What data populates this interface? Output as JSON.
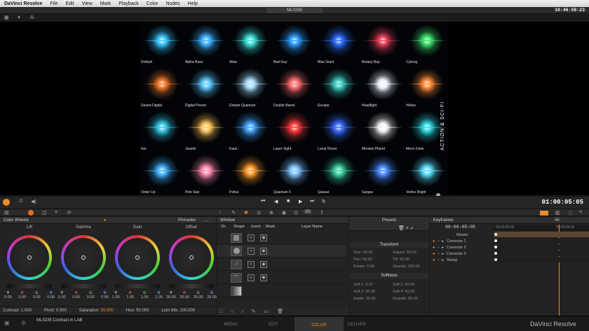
{
  "menubar": {
    "app": "DaVinci Resolve",
    "items": [
      "File",
      "Edit",
      "View",
      "Mark",
      "Playback",
      "Color",
      "Nodes",
      "Help"
    ],
    "clock": "10:46:59:23"
  },
  "viewer": {
    "clip": "ML0235",
    "side_label": "ACTION & SCI-FI"
  },
  "presets": [
    {
      "label": "Default",
      "color": "#39c6ff"
    },
    {
      "label": "Alpha Base",
      "color": "#3fb1ff"
    },
    {
      "label": "Atlas",
      "color": "#3ee0d8"
    },
    {
      "label": "Bad Guy",
      "color": "#2f9cff"
    },
    {
      "label": "Blue Giant",
      "color": "#2b6bff"
    },
    {
      "label": "Botany Bay",
      "color": "#e2405b"
    },
    {
      "label": "Cyborg",
      "color": "#3de06b"
    },
    {
      "label": "Desert Digital",
      "color": "#f07a2a"
    },
    {
      "label": "Digital Preset",
      "color": "#5cc8ff"
    },
    {
      "label": "Distant Quantum",
      "color": "#a8dcff"
    },
    {
      "label": "Double Barrel",
      "color": "#ff6f72"
    },
    {
      "label": "Escape",
      "color": "#3cc9c0"
    },
    {
      "label": "Headlight",
      "color": "#eef3ff"
    },
    {
      "label": "Helios",
      "color": "#ff8a3a"
    },
    {
      "label": "Isis",
      "color": "#34c9e8"
    },
    {
      "label": "Javelin",
      "color": "#ffc65c"
    },
    {
      "label": "Kaus",
      "color": "#3fa3ff"
    },
    {
      "label": "Laser Sight",
      "color": "#ff3b3b"
    },
    {
      "label": "Lunar Rover",
      "color": "#3a6bff"
    },
    {
      "label": "Monkey Planet",
      "color": "#f3f3f3"
    },
    {
      "label": "Moon Glow",
      "color": "#2ed7e0"
    },
    {
      "label": "Order Up",
      "color": "#3fb4ff"
    },
    {
      "label": "Pink Star",
      "color": "#ff8bb0"
    },
    {
      "label": "Pollux",
      "color": "#ff9a2a"
    },
    {
      "label": "Quantum 5",
      "color": "#7cc3ff"
    },
    {
      "label": "Quasar",
      "color": "#3ad0a0"
    },
    {
      "label": "Sargas",
      "color": "#4a8bff"
    },
    {
      "label": "Vortex Bright",
      "color": "#5ae0ff"
    }
  ],
  "transport": {
    "timecode": "01:00:05:05",
    "icons": [
      "skip-start-icon",
      "step-back-icon",
      "stop-icon",
      "play-icon",
      "skip-end-icon",
      "loop-icon"
    ]
  },
  "toolbar2": {
    "badge": "3D"
  },
  "color_wheels": {
    "title": "Color Wheels",
    "mode": "Primaries",
    "wheels": [
      {
        "name": "Lift",
        "values": [
          "0.00",
          "0.00",
          "0.00",
          "0.00"
        ]
      },
      {
        "name": "Gamma",
        "values": [
          "0.00",
          "0.00",
          "0.00",
          "0.00"
        ]
      },
      {
        "name": "Gain",
        "values": [
          "1.00",
          "1.00",
          "1.00",
          "1.00"
        ]
      },
      {
        "name": "Offset",
        "values": [
          "25.00",
          "25.00",
          "25.00",
          "25.00"
        ]
      }
    ],
    "channels": [
      "Y",
      "R",
      "G",
      "B"
    ],
    "params": {
      "contrast": "Contrast: 1.000",
      "pivot": "Pivot: 0.500",
      "saturation_label": "Saturation:",
      "saturation_value": "50.000",
      "hue": "Hue: 50.000",
      "lum_mix": "Lum Mix: 100.000"
    }
  },
  "window": {
    "title": "Window",
    "columns": [
      "On",
      "Shape",
      "Invert",
      "Mask",
      "Layer Name"
    ]
  },
  "presets_panel": {
    "title": "Presets",
    "transform_title": "Transform",
    "softness_title": "Softness",
    "transform": [
      [
        "Size: 50.00",
        "Aspect: 50.00"
      ],
      [
        "Pan: 50.00",
        "Tilt: 50.00"
      ],
      [
        "Rotate: 0.00",
        "Opacity: 100.00"
      ]
    ],
    "softness": [
      [
        "Soft 1: 2.07",
        "Soft 2: 50.00"
      ],
      [
        "Soft 3: 50.00",
        "Soft 4: 50.00"
      ],
      [
        "Inside: 50.00",
        "Outside: 50.00"
      ]
    ]
  },
  "keyframes": {
    "title": "Keyframes",
    "filter": "All",
    "timecode": "00:00:05:05",
    "ruler": [
      "00:00:00:00",
      "00:00:04:20"
    ],
    "tracks": [
      "Master",
      "Corrector 1",
      "Corrector 2",
      "Corrector 3",
      "Sizing"
    ]
  },
  "status": {
    "text": "ML0235 Contrast in LAB"
  },
  "pages": [
    "MEDIA",
    "EDIT",
    "COLOR",
    "DELIVER"
  ],
  "brand": "DaVinci Resolve"
}
